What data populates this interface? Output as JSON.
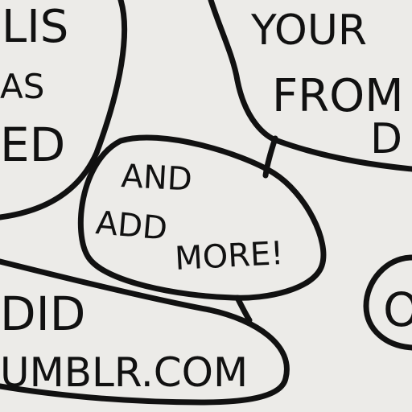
{
  "bubbles": {
    "top_left": {
      "lines": [
        "LIS",
        "AS",
        "ED"
      ]
    },
    "top_right": {
      "lines": [
        "YOUR",
        "FROM",
        "D"
      ]
    },
    "center": {
      "lines": [
        "AND",
        "ADD",
        "MORE!"
      ]
    },
    "bottom_left": {
      "lines": [
        "DID",
        "UMBLR.COM"
      ]
    },
    "right": {
      "lines": [
        "O"
      ]
    }
  },
  "colors": {
    "paper": "#ecebe8",
    "ink": "#111111"
  }
}
